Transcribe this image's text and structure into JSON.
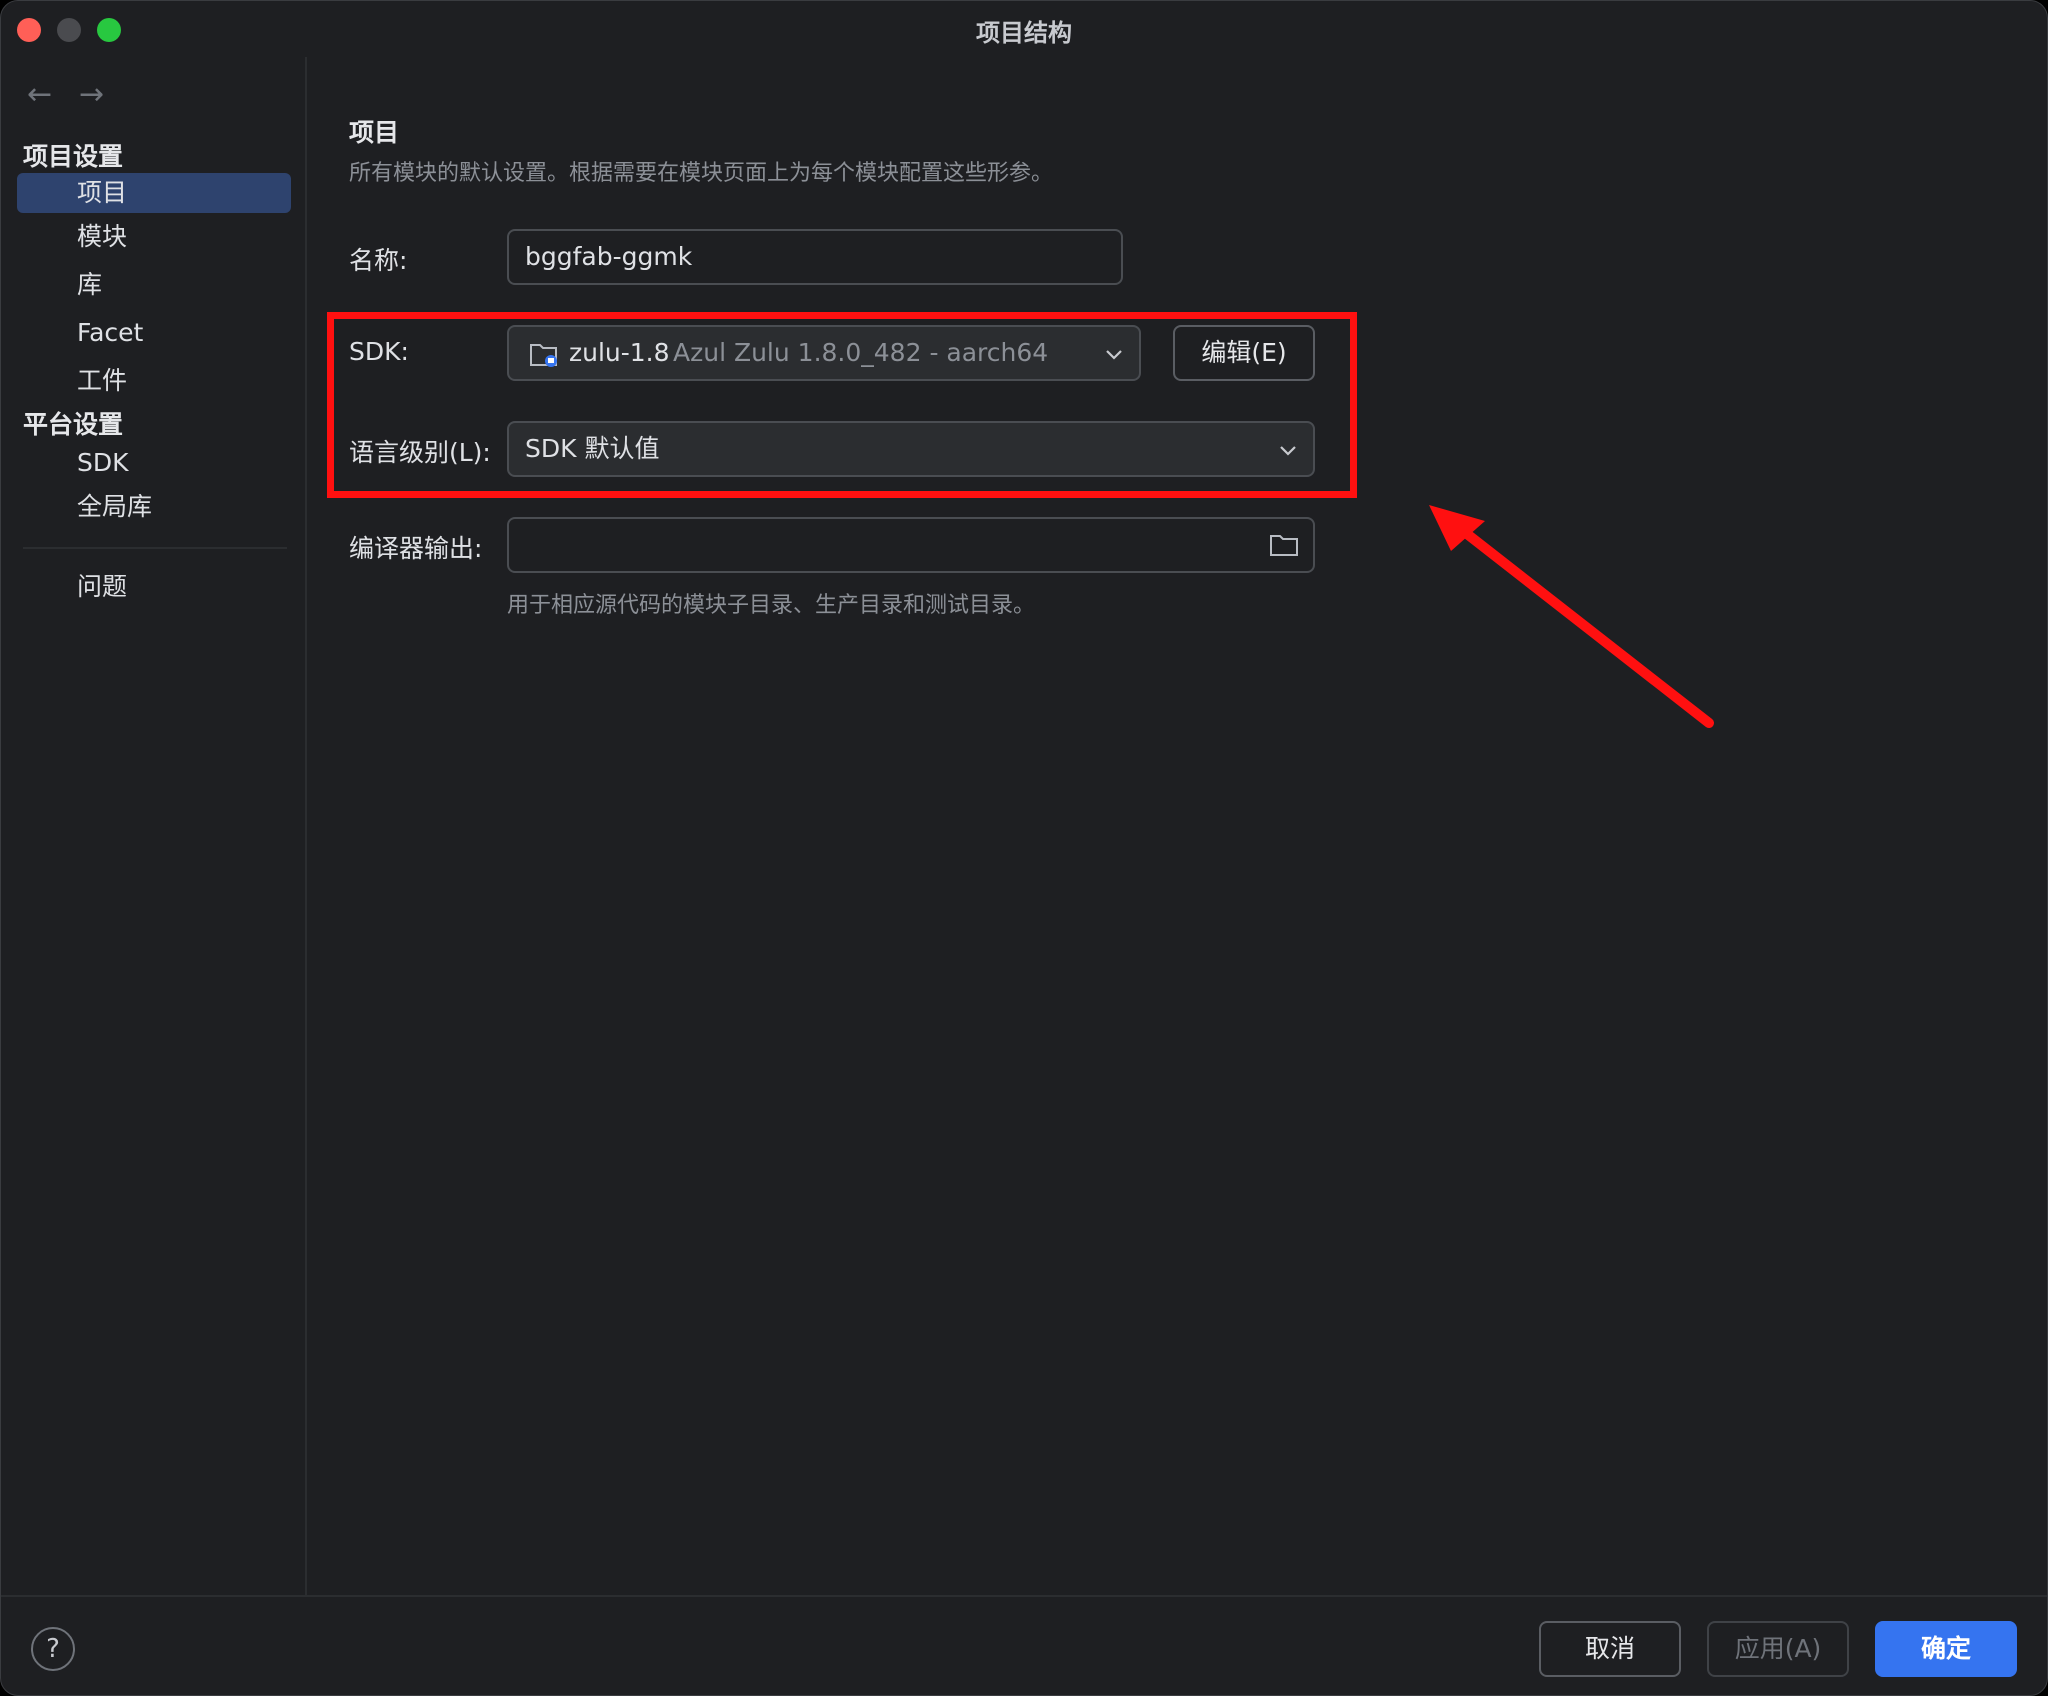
{
  "window": {
    "title": "项目结构"
  },
  "sidebar": {
    "back_icon": "←",
    "forward_icon": "→",
    "project_settings_header": "项目设置",
    "project_items": [
      "项目",
      "模块",
      "库",
      "Facet",
      "工件"
    ],
    "platform_settings_header": "平台设置",
    "platform_items": [
      "SDK",
      "全局库"
    ],
    "problems": "问题",
    "selected": "项目"
  },
  "content": {
    "title": "项目",
    "description": "所有模块的默认设置。根据需要在模块页面上为每个模块配置这些形参。",
    "name_label": "名称:",
    "name_value": "bggfab-ggmk",
    "sdk_label": "SDK:",
    "sdk_name": "zulu-1.8",
    "sdk_detail": "Azul Zulu 1.8.0_482 - aarch64",
    "sdk_edit_button": "编辑(E)",
    "language_level_label": "语言级别(L):",
    "language_level_value": "SDK 默认值",
    "compiler_output_label": "编译器输出:",
    "compiler_output_value": "",
    "compiler_output_hint": "用于相应源代码的模块子目录、生产目录和测试目录。"
  },
  "footer": {
    "help": "?",
    "cancel": "取消",
    "apply": "应用(A)",
    "ok": "确定"
  },
  "annotation_color": "#ff1010",
  "accent_color": "#3574f0"
}
